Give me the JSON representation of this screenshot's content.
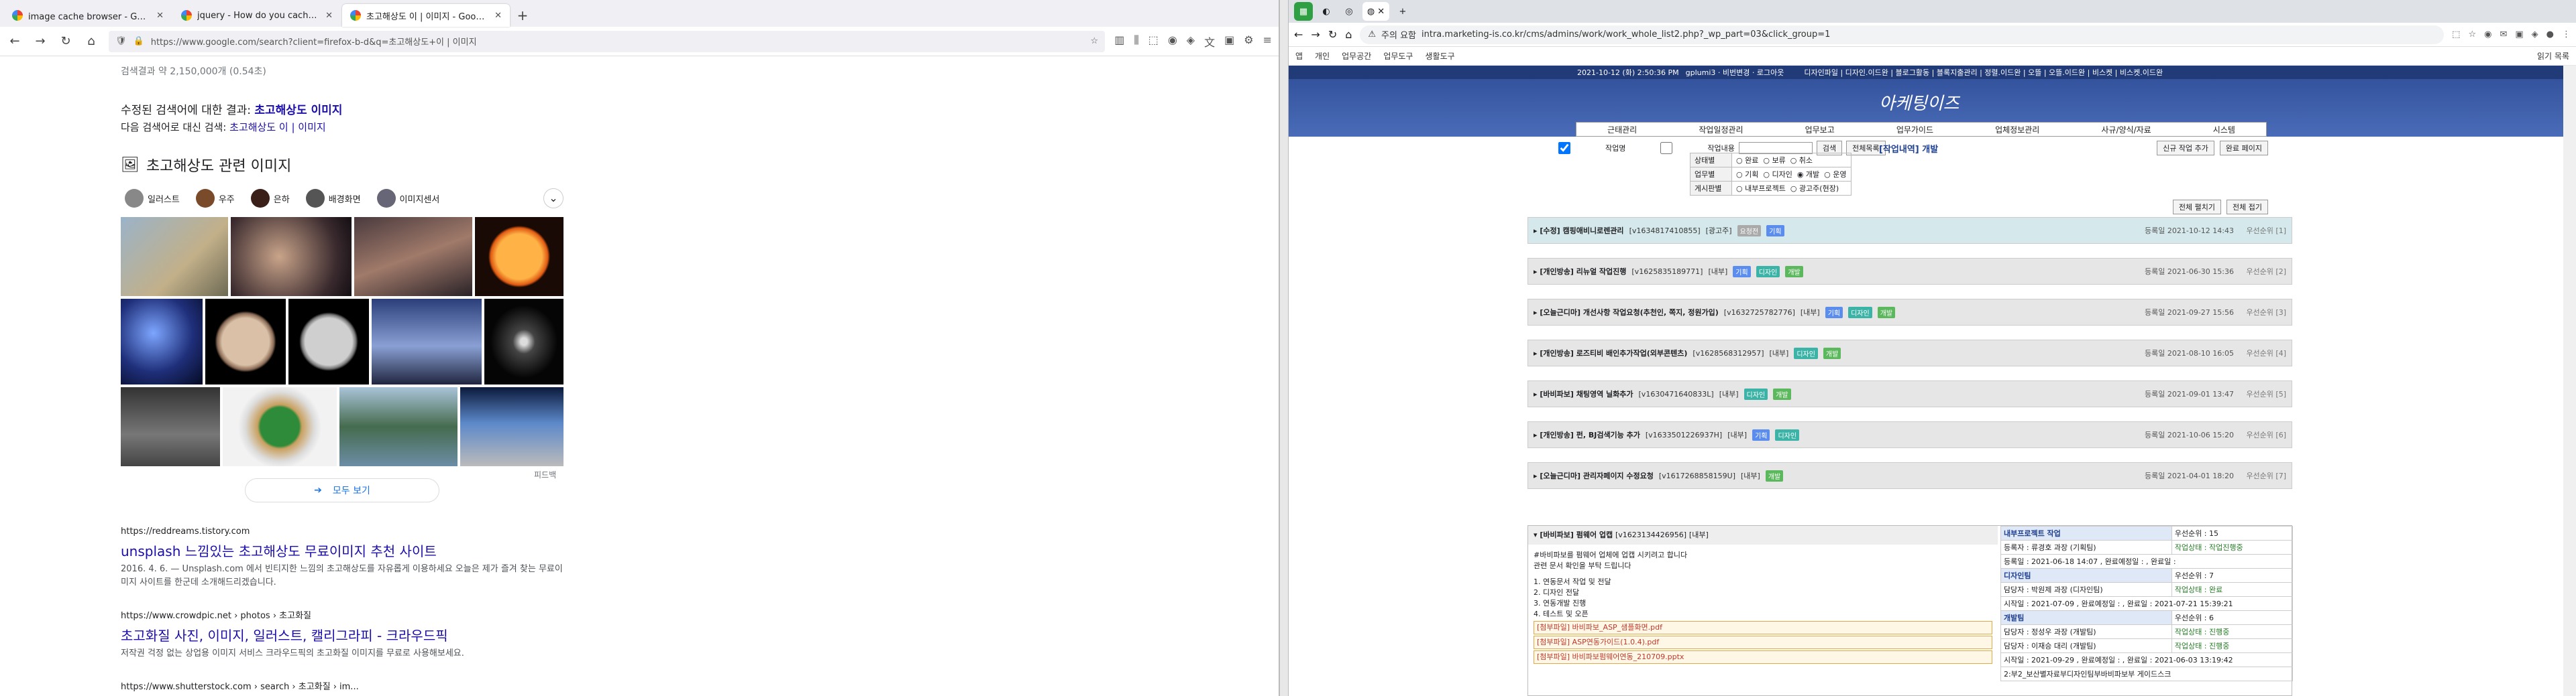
{
  "left_browser": {
    "tabs": [
      {
        "label": "image cache browser - Google 검색"
      },
      {
        "label": "jquery - How do you cache an ima"
      },
      {
        "label": "초고해상도 이 | 이미지 - Google 검색"
      }
    ],
    "url": "https://www.google.com/search?client=firefox-b-d&q=초고해상도+이 | 이미지",
    "results_count": "검색결과 약 2,150,000개 (0.54초)",
    "corrected_prefix": "수정된 검색어에 대한 결과:",
    "corrected_query": "초고해상도 이미지",
    "instead_prefix": "다음 검색어로 대신 검색:",
    "instead_query": "초고해상도 이 | 이미지",
    "images_heading": "초고해상도 관련 이미지",
    "chips": [
      {
        "label": "일러스트",
        "color": "#888"
      },
      {
        "label": "우주",
        "color": "#7a4b2a"
      },
      {
        "label": "은하",
        "color": "#3a2018"
      },
      {
        "label": "배경화면",
        "color": "#555"
      },
      {
        "label": "이미지센서",
        "color": "#667"
      }
    ],
    "see_all": "모두 보기",
    "feedback": "피드백",
    "results": [
      {
        "site": "https://reddreams.tistory.com",
        "title": "unsplash 느낌있는 초고해상도 무료이미지 추천 사이트",
        "snippet": "2016. 4. 6. — Unsplash.com 에서 빈티지한 느낌의 초고해상도를 자유롭게 이용하세요 오늘은 제가 즐겨 찾는 무료이미지 사이트를 한군데 소개해드리겠습니다."
      },
      {
        "site": "https://www.crowdpic.net › photos › 초고화질",
        "title": "초고화질 사진, 이미지, 일러스트, 캘리그라피 - 크라우드픽",
        "snippet": "저작권 걱정 없는 상업용 이미지 서비스 크라우드픽의 초고화질 이미지를 무료로 사용해보세요."
      },
      {
        "site": "https://www.shutterstock.com › search › 초고화질 › im...",
        "title": "",
        "snippet": ""
      }
    ]
  },
  "right_browser": {
    "url": "intra.marketing-is.co.kr/cms/admins/work/work_whole_list2.php?_wp_part=03&click_group=1",
    "security": "주의 요함",
    "bookmarks": [
      "앱",
      "개인",
      "업무공간",
      "업무도구",
      "생활도구",
      "읽기 목록"
    ],
    "top_info": "2021-10-12 (화) 2:50:36 PM",
    "user": "gplumi3 · 비번변경 · 로그아웃",
    "top_links": "디자인파일 | 디자인.이드완 | 블로그활동 | 블록지출관리 | 정렬.이드완 | 오뜰 | 오뜰.이드완 | 비스켓 | 비스켓.이드완",
    "logo": "아케팅이즈",
    "menu": [
      "근태관리",
      "작업일정관리",
      "업무보고",
      "업무가이드",
      "업체정보관리",
      "사규/양식/자료",
      "시스템"
    ],
    "search": {
      "chk1": "작업명",
      "chk2": "작업내용",
      "btn": "검색",
      "all": "전체목록"
    },
    "page_title": "[작업내역] 개발",
    "btn_new": "신규 작업 추가",
    "btn_page": "완료 페이지",
    "filters": [
      {
        "label": "상태별",
        "opts": [
          "완료",
          "보류",
          "취소"
        ]
      },
      {
        "label": "업무별",
        "opts": [
          "기획",
          "디자인",
          "개발",
          "운영"
        ]
      },
      {
        "label": "게시판별",
        "opts": [
          "내부프로젝트",
          "광고주(현장)"
        ]
      }
    ],
    "btn_expand": "전체 펼치기",
    "btn_collapse": "전체 접기",
    "rows": [
      {
        "title": "▸ [수정] 캠핑애비니로렌관리",
        "code": "[v1634817410855]",
        "tag": "[광고주]",
        "badges": [
          "요청전",
          "기획"
        ],
        "date": "등록일 2021-10-12 14:43",
        "pri": "우선순위 [1]"
      },
      {
        "title": "▸ [개인방송] 리뉴얼 작업진행",
        "code": "[v1625835189771]",
        "tag": "[내부]",
        "badges": [
          "기획",
          "디자인",
          "개발"
        ],
        "date": "등록일 2021-06-30 15:36",
        "pri": "우선순위 [2]"
      },
      {
        "title": "▸ [오늘근디마] 개선사항 작업요청(추천인, 쪽지, 정원가입)",
        "code": "[v1632725782776]",
        "tag": "[내부]",
        "badges": [
          "기획",
          "디자인",
          "개발"
        ],
        "date": "등록일 2021-09-27 15:56",
        "pri": "우선순위 [3]"
      },
      {
        "title": "▸ [개인방송] 로즈티비 배인추가작업(외부콘텐츠)",
        "code": "[v1628568312957]",
        "tag": "[내부]",
        "badges": [
          "디자인",
          "개발"
        ],
        "date": "등록일 2021-08-10 16:05",
        "pri": "우선순위 [4]"
      },
      {
        "title": "▸ [바비파보] 채팅영역 닐화추가",
        "code": "[v1630471640833L]",
        "tag": "[내부]",
        "badges": [
          "디자인",
          "개발"
        ],
        "date": "등록일 2021-09-01 13:47",
        "pri": "우선순위 [5]"
      },
      {
        "title": "▸ [개인방송] 펀, BJ검색기능 추가",
        "code": "[v1633501226937H]",
        "tag": "[내부]",
        "badges": [
          "기획",
          "디자인"
        ],
        "date": "등록일 2021-10-06 15:20",
        "pri": "우선순위 [6]"
      },
      {
        "title": "▸ [오늘근디마] 관리자페이지 수정요청",
        "code": "[v1617268858159U]",
        "tag": "[내부]",
        "badges": [
          "개발"
        ],
        "date": "등록일 2021-04-01 18:20",
        "pri": "우선순위 [7]"
      }
    ],
    "detail": {
      "title": "▾ [바비파보] 펌웨어 업캡",
      "code": "[v1623134426956]",
      "tag": "[내부]",
      "lines": [
        "#바비파보를 펌웨어 업체에 업캡 시키려고 합니다",
        "관련 문서 확인을 부탁 드립니다",
        "1. 연동문서 작업 및 전달",
        "2. 디자인 전달",
        "3. 연동개발 진행",
        "4. 테스트 및 오픈"
      ],
      "attachments": [
        "[첨부파일] 바비파보_ASP_샘플화면.pdf",
        "[첨부파일] ASP연동가이드(1.0.4).pdf",
        "[첨부파일] 바비파보펌웨어연동_210709.pptx"
      ],
      "side": {
        "sec1": "내부프로젝트 작업",
        "pri": "우선순위 : 15",
        "r1": "등록자 : 류경호 과장 (기획팀)",
        "r2": "작업상태 : 작업진행중",
        "r3": "등록일 : 2021-06-18 14:07 , 완료예정일 : , 완료일 :",
        "sec2": "디자인팀",
        "sec2b": "우선순위 : 7",
        "r4": "담당자 : 박원제 과장 (디자인팀)",
        "r5": "작업상태 : 완료",
        "r6": "시작일 : 2021-07-09 , 완료예정일 : , 완료일 : 2021-07-21 15:39:21",
        "sec3": "개발팀",
        "sec3b": "우선순위 : 6",
        "r7": "담당자 : 정성우 과장 (개발팀)",
        "r8": "작업상태 : 진행중",
        "r9": "담당자 : 이재승 대리 (개발팀)",
        "r10": "작업상태 : 진행중",
        "r11": "시작일 : 2021-09-29 , 완료예정일 : , 완료일 : 2021-06-03 13:19:42",
        "r12": "2:부2_보산별자료부디자인팀부바비파보부 게이드스크"
      }
    }
  }
}
